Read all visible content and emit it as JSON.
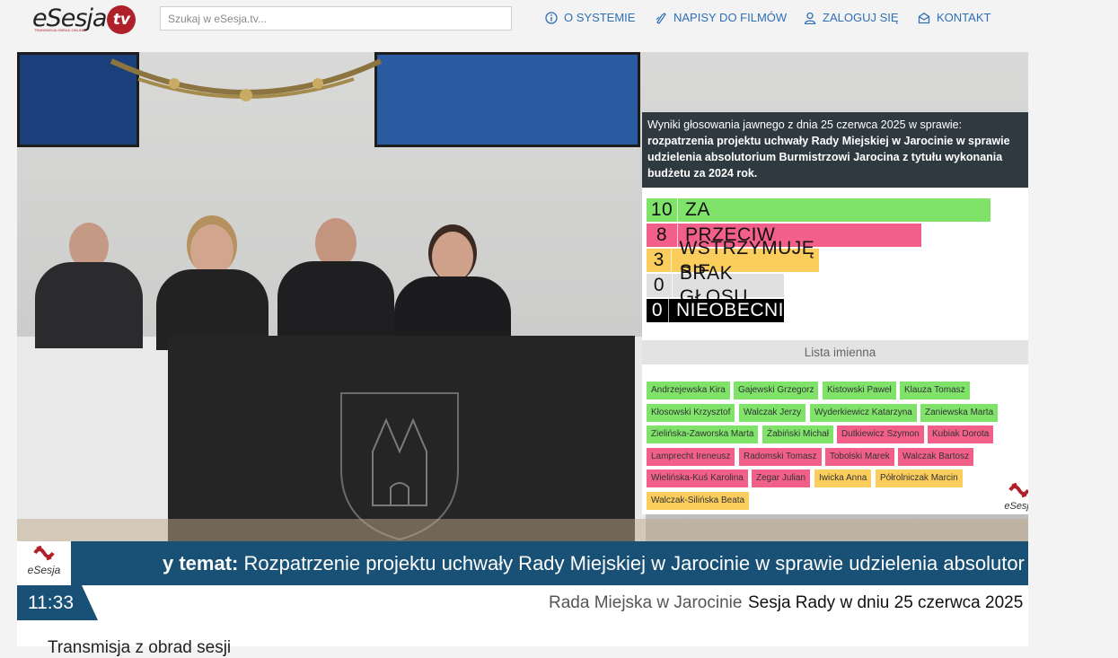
{
  "header": {
    "logo_main": "eSesja",
    "logo_tv": "tv",
    "logo_tagline": "TRANSMISJA OBRAD ONLINE",
    "search_placeholder": "Szukaj w eSesja.tv...",
    "nav": [
      {
        "label": "O SYSTEMIE",
        "icon": "info-icon"
      },
      {
        "label": "NAPISY DO FILMÓW",
        "icon": "subtitles-icon"
      },
      {
        "label": "ZALOGUJ SIĘ",
        "icon": "user-icon"
      },
      {
        "label": "KONTAKT",
        "icon": "mail-icon"
      }
    ],
    "accent_color": "#2f6fb5"
  },
  "results": {
    "intro": "Wyniki głosowania jawnego z dnia 25 czerwca 2025 w sprawie:",
    "subject": "rozpatrzenia projektu uchwały Rady Miejskiej w Jarocinie w sprawie udzielenia absolutorium Burmistrzowi Jarocina z tytułu wykonania budżetu za 2024 rok.",
    "votes": [
      {
        "count": "10",
        "label": "ZA",
        "color": "#7fe36a",
        "text_color": "#111",
        "share": 1.0
      },
      {
        "count": "8",
        "label": "PRZECIW",
        "color": "#f2608a",
        "text_color": "#111",
        "share": 0.8
      },
      {
        "count": "3",
        "label": "WSTRZYMUJĘ SIĘ",
        "color": "#fbcd5d",
        "text_color": "#111",
        "share": 0.5
      },
      {
        "count": "0",
        "label": "BRAK GŁOSU",
        "color": "#e0e0e0",
        "text_color": "#111",
        "share": 0.4
      },
      {
        "count": "0",
        "label": "NIEOBECNI",
        "color": "#000000",
        "text_color": "#fff",
        "share": 0.4
      }
    ],
    "list_title": "Lista imienna",
    "names": [
      [
        {
          "n": "Andrzejewska Kira",
          "v": "green"
        },
        {
          "n": "Gajewski Grzegorz",
          "v": "green"
        },
        {
          "n": "Kistowski Paweł",
          "v": "green"
        },
        {
          "n": "Klauza Tomasz",
          "v": "green"
        }
      ],
      [
        {
          "n": "Kłosowski Krzysztof",
          "v": "green"
        },
        {
          "n": "Walczak Jerzy",
          "v": "green"
        },
        {
          "n": "Wyderkiewicz Katarzyna",
          "v": "green"
        },
        {
          "n": "Zaniewska Marta",
          "v": "green"
        }
      ],
      [
        {
          "n": "Zielińska-Zaworska Marta",
          "v": "green"
        },
        {
          "n": "Żabiński Michał",
          "v": "green"
        },
        {
          "n": "Dutkiewicz Szymon",
          "v": "red"
        },
        {
          "n": "Kubiak Dorota",
          "v": "red"
        }
      ],
      [
        {
          "n": "Lamprecht Ireneusz",
          "v": "red"
        },
        {
          "n": "Radomski Tomasz",
          "v": "red"
        },
        {
          "n": "Tobolski Marek",
          "v": "red"
        },
        {
          "n": "Walczak Bartosz",
          "v": "red"
        }
      ],
      [
        {
          "n": "Wielińska-Kuś Karolina",
          "v": "red"
        },
        {
          "n": "Zegar Julian",
          "v": "red"
        },
        {
          "n": "Iwicka Anna",
          "v": "yellow"
        },
        {
          "n": "Półrolniczak Marcin",
          "v": "yellow"
        }
      ],
      [
        {
          "n": "Walczak-Silińska Beata",
          "v": "yellow"
        }
      ]
    ],
    "logo": "eSesja"
  },
  "ticker": {
    "prefix": "y temat:",
    "text": " Rozpatrzenie projektu uchwały Rady Miejskiej w Jarocinie w sprawie udzielenia absolutor",
    "logo": "eSesja"
  },
  "info": {
    "time": "11:33",
    "council": "Rada Miejska w Jarocinie",
    "session": "Sesja Rady w dniu 25 czerwca 2025"
  },
  "below": {
    "text": "Transmisja z obrad sesji"
  }
}
